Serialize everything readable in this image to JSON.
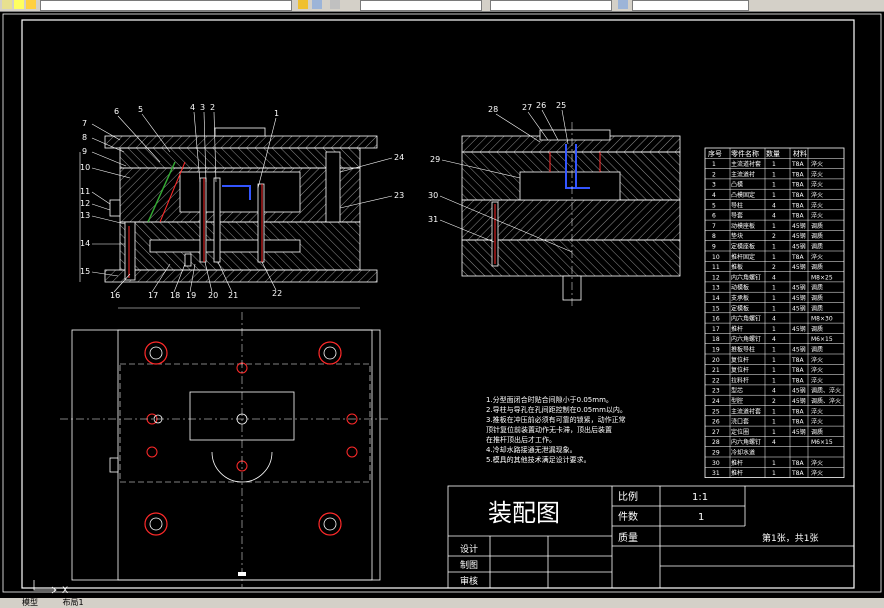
{
  "toolbar": {
    "icons": [
      "layer-icon",
      "lightbulb-icon",
      "sun-icon",
      "layers-icon",
      "color-swatch-icon",
      "linetype-icon",
      "lineweight-icon"
    ]
  },
  "notes": [
    "1.分型面闭合时贴合间隙小于0.05mm。",
    "2.导柱与导孔在孔间距控制在0.05mm以内。",
    "3.推板在冲压前必须有可靠的锁紧，动作正常",
    "顶针复位前装置动作无卡滞，顶出后装置",
    "在推杆顶出后才工作。",
    "4.冷却水路接通无泄漏现象。",
    "5.模具的其他技术满足设计要求。"
  ],
  "bom": {
    "headers": [
      "序号",
      "零件名称",
      "数量",
      "材料"
    ],
    "rows": [
      [
        "1",
        "主流道衬套",
        "1",
        "T8A",
        "淬火"
      ],
      [
        "2",
        "主流道衬",
        "1",
        "T8A",
        "淬火"
      ],
      [
        "3",
        "凸模",
        "1",
        "T8A",
        "淬火"
      ],
      [
        "4",
        "凸模固定",
        "1",
        "T8A",
        "淬火"
      ],
      [
        "5",
        "导柱",
        "4",
        "T8A",
        "淬火"
      ],
      [
        "6",
        "导套",
        "4",
        "T8A",
        "淬火"
      ],
      [
        "7",
        "动模座板",
        "1",
        "45钢",
        "调质"
      ],
      [
        "8",
        "垫块",
        "2",
        "45钢",
        "调质"
      ],
      [
        "9",
        "定模座板",
        "1",
        "45钢",
        "调质"
      ],
      [
        "10",
        "推杆固定",
        "1",
        "T8A",
        "淬火"
      ],
      [
        "11",
        "推板",
        "2",
        "45钢",
        "调质"
      ],
      [
        "12",
        "内六角螺钉",
        "4",
        "",
        "M8×25"
      ],
      [
        "13",
        "动模板",
        "1",
        "45钢",
        "调质"
      ],
      [
        "14",
        "支承板",
        "1",
        "45钢",
        "调质"
      ],
      [
        "15",
        "定模板",
        "1",
        "45钢",
        "调质"
      ],
      [
        "16",
        "内六角螺钉",
        "4",
        "",
        "M8×30"
      ],
      [
        "17",
        "推杆",
        "1",
        "45钢",
        "调质"
      ],
      [
        "18",
        "内六角螺钉",
        "4",
        "",
        "M6×15"
      ],
      [
        "19",
        "推板导柱",
        "1",
        "45钢",
        "调质"
      ],
      [
        "20",
        "复位杆",
        "1",
        "T8A",
        "淬火"
      ],
      [
        "21",
        "复位杆",
        "1",
        "T8A",
        "淬火"
      ],
      [
        "22",
        "拉料杆",
        "1",
        "T8A",
        "淬火"
      ],
      [
        "23",
        "型芯",
        "4",
        "45钢",
        "调质、淬火"
      ],
      [
        "24",
        "型腔",
        "2",
        "45钢",
        "调质、淬火"
      ],
      [
        "25",
        "主流道衬套",
        "1",
        "T8A",
        "淬火"
      ],
      [
        "26",
        "浇口套",
        "1",
        "T8A",
        "淬火"
      ],
      [
        "27",
        "定位圈",
        "1",
        "45钢",
        "调质"
      ],
      [
        "28",
        "内六角螺钉",
        "4",
        "",
        "M6×15"
      ],
      [
        "29",
        "冷却水道",
        "",
        "",
        ""
      ],
      [
        "30",
        "推杆",
        "1",
        "T8A",
        "淬火"
      ],
      [
        "31",
        "推杆",
        "1",
        "T8A",
        "淬火"
      ]
    ]
  },
  "title_block": {
    "title": "装配图",
    "scale_label": "比例",
    "scale_value": "1:1",
    "count_label": "件数",
    "count_value": "1",
    "mass_label": "质量",
    "sheet_text": "第1张，共1张",
    "design_label": "设计",
    "drawing_label": "制图",
    "review_label": "审核"
  },
  "callouts_left": [
    "7",
    "8",
    "9",
    "10",
    "11",
    "12",
    "13",
    "14",
    "15",
    "6",
    "5",
    "4",
    "3",
    "2",
    "1",
    "24",
    "23",
    "16",
    "17",
    "18",
    "19",
    "20",
    "21",
    "22"
  ],
  "callouts_right": [
    "28",
    "27",
    "26",
    "25",
    "29",
    "30",
    "31"
  ],
  "status": {
    "tab_model": "模型",
    "tab_layout": "布局1"
  },
  "colors": {
    "background": "#000000",
    "lines": "#ffffff",
    "section_red": "#ff2a2a",
    "part_blue": "#3355ff",
    "toolbar": "#d4d0c8"
  }
}
